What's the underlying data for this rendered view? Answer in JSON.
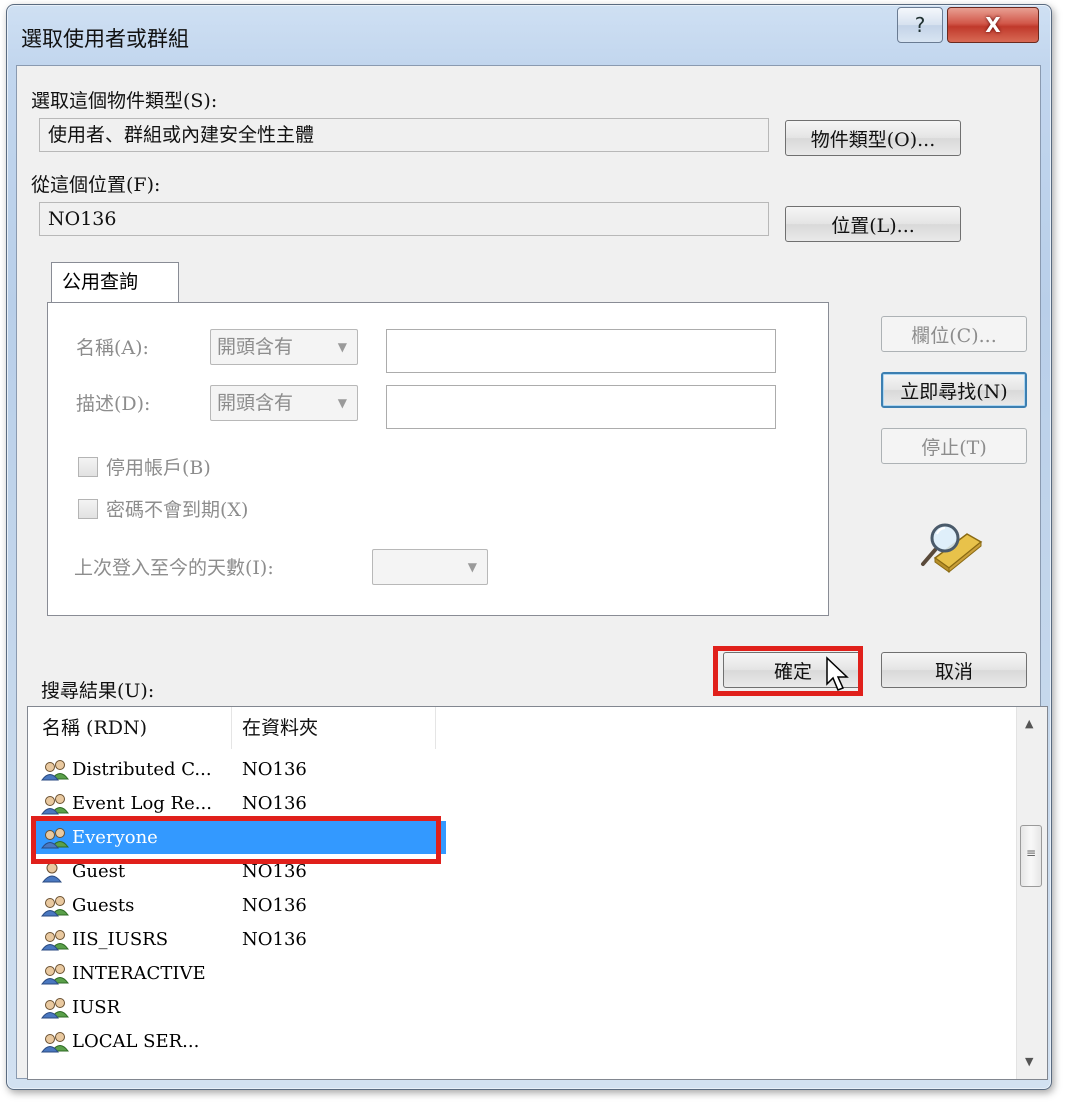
{
  "window": {
    "title": "選取使用者或群組",
    "help_symbol": "?",
    "close_symbol": "X"
  },
  "object_type": {
    "label": "選取這個物件類型(S):",
    "value": "使用者、群組或內建安全性主體",
    "button": "物件類型(O)..."
  },
  "location": {
    "label": "從這個位置(F):",
    "value": "NO136",
    "button": "位置(L)..."
  },
  "query_tab": {
    "tab_label": "公用查詢",
    "name_label": "名稱(A):",
    "name_mode": "開頭含有",
    "name_value": "",
    "desc_label": "描述(D):",
    "desc_mode": "開頭含有",
    "desc_value": "",
    "disabled_accounts": "停用帳戶(B)",
    "non_expiring_password": "密碼不會到期(X)",
    "days_since_logon_label": "上次登入至今的天數(I):",
    "days_since_logon_value": ""
  },
  "side_buttons": {
    "columns": "欄位(C)...",
    "find_now": "立即尋找(N)",
    "stop": "停止(T)"
  },
  "dialog_buttons": {
    "ok": "確定",
    "cancel": "取消"
  },
  "results": {
    "label": "搜尋結果(U):",
    "columns": [
      "名稱 (RDN)",
      "在資料夾"
    ],
    "rows": [
      {
        "name": "Distributed C...",
        "folder": "NO136",
        "icon": "group-icon"
      },
      {
        "name": "Event Log Re...",
        "folder": "NO136",
        "icon": "group-icon"
      },
      {
        "name": "Everyone",
        "folder": "",
        "icon": "group-icon",
        "selected": true
      },
      {
        "name": "Guest",
        "folder": "NO136",
        "icon": "user-icon"
      },
      {
        "name": "Guests",
        "folder": "NO136",
        "icon": "group-icon"
      },
      {
        "name": "IIS_IUSRS",
        "folder": "NO136",
        "icon": "group-icon"
      },
      {
        "name": "INTERACTIVE",
        "folder": "",
        "icon": "group-icon"
      },
      {
        "name": "IUSR",
        "folder": "",
        "icon": "group-icon"
      },
      {
        "name": "LOCAL SER...",
        "folder": "",
        "icon": "group-icon"
      }
    ]
  },
  "colors": {
    "highlight_box": "#e0201b",
    "selection": "#3399ff"
  }
}
